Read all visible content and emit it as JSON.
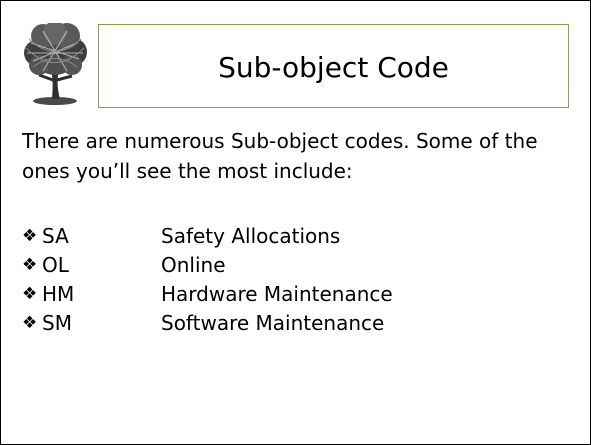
{
  "slide": {
    "title": "Sub-object Code",
    "intro": "There are numerous Sub-object codes. Some of the ones you’ll see the most include:",
    "bullet_glyph": "❖",
    "accent_color": "#7FA64A",
    "logo_icon": "tree-icon",
    "items": [
      {
        "code": "SA",
        "description": "Safety Allocations"
      },
      {
        "code": "OL",
        "description": "Online"
      },
      {
        "code": "HM",
        "description": "Hardware Maintenance"
      },
      {
        "code": "SM",
        "description": "Software Maintenance"
      }
    ]
  }
}
